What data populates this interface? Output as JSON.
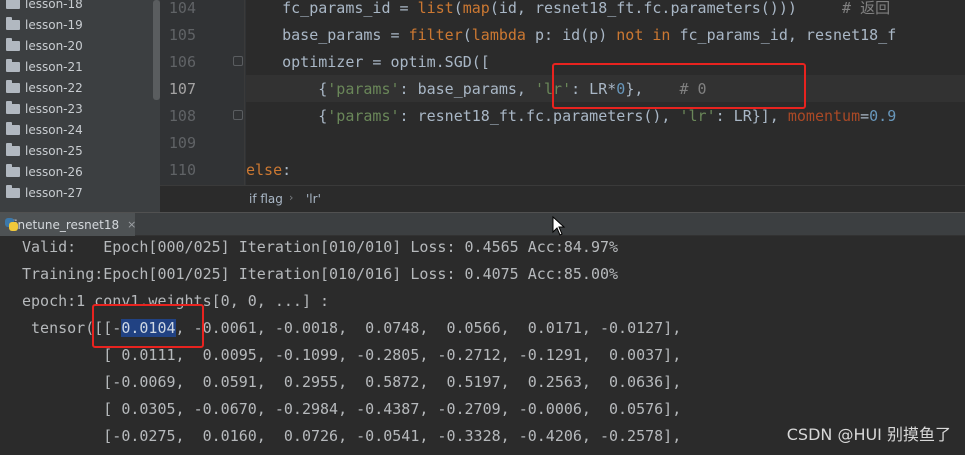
{
  "project_tree": {
    "items": [
      {
        "label": "lesson-18"
      },
      {
        "label": "lesson-19"
      },
      {
        "label": "lesson-20"
      },
      {
        "label": "lesson-21"
      },
      {
        "label": "lesson-22"
      },
      {
        "label": "lesson-23"
      },
      {
        "label": "lesson-24"
      },
      {
        "label": "lesson-25"
      },
      {
        "label": "lesson-26"
      },
      {
        "label": "lesson-27"
      }
    ]
  },
  "editor": {
    "line_numbers": [
      "104",
      "105",
      "106",
      "107",
      "108",
      "109",
      "110"
    ],
    "current_line": "107",
    "lines": {
      "l104": {
        "code": "    fc_params_id = ",
        "fn1": "list",
        "p1": "(",
        "fn2": "map",
        "rest": "(id, resnet18_ft.fc.parameters()))",
        "comment": "     # 返回"
      },
      "l105": {
        "code": "    base_params = ",
        "fn": "filter",
        "p": "(",
        "kw": "lambda",
        "rest": " p: id(p) ",
        "kw2": "not in",
        "rest2": " fc_params_id, resnet18_f"
      },
      "l106": {
        "code": "    optimizer = optim.SGD(["
      },
      "l107": {
        "pre": "        {",
        "s1": "'params'",
        "mid": ": base_params, ",
        "s2": "'lr'",
        "mid2": ": LR*",
        "n": "0",
        "end": "},",
        "comment": "    # 0"
      },
      "l108": {
        "pre": "        {",
        "s1": "'params'",
        "mid": ": resnet18_ft.fc.parameters(), ",
        "s2": "'lr'",
        "mid2": ": LR}], ",
        "kwarg": "momentum",
        "eq": "=",
        "n": "0.9"
      },
      "l110": {
        "kw": "else",
        "rest": ":"
      }
    }
  },
  "breadcrumb": {
    "items": [
      "if flag",
      "'lr'"
    ],
    "separator": "›"
  },
  "run_panel": {
    "tab_label": "finetune_resnet18",
    "close_label": "×"
  },
  "console": {
    "lines": [
      "Valid:   Epoch[000/025] Iteration[010/010] Loss: 0.4565 Acc:84.97%",
      "Training:Epoch[001/025] Iteration[010/016] Loss: 0.4075 Acc:85.00%",
      "epoch:1 conv1.weights[0, 0, ...] :",
      {
        "prefix": " tensor([[-",
        "selected": "0.0104",
        "suffix": ", -0.0061, -0.0018,  0.0748,  0.0566,  0.0171, -0.0127],"
      },
      "         [ 0.0111,  0.0095, -0.1099, -0.2805, -0.2712, -0.1291,  0.0037],",
      "         [-0.0069,  0.0591,  0.2955,  0.5872,  0.5197,  0.2563,  0.0636],",
      "         [ 0.0305, -0.0670, -0.2984, -0.4387, -0.2709, -0.0006,  0.0576],",
      "         [-0.0275,  0.0160,  0.0726, -0.0541, -0.3328, -0.4206, -0.2578],"
    ]
  },
  "watermark": "CSDN @HUI 别摸鱼了",
  "colors": {
    "callout": "#e8231f",
    "keyword": "#cc7832",
    "string": "#6a8759",
    "number": "#6897bb",
    "selection": "#214283"
  }
}
